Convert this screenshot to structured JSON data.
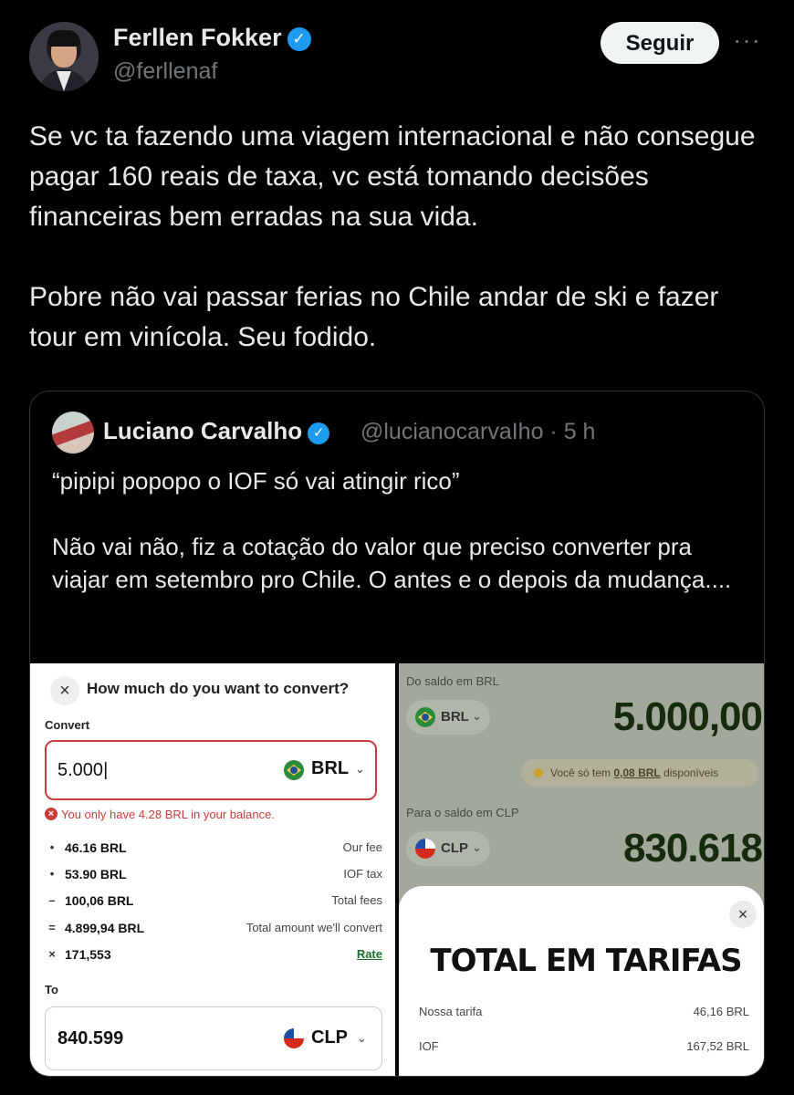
{
  "author": {
    "name": "Ferllen Fokker",
    "handle": "@ferllenaf",
    "follow_label": "Seguir",
    "more_label": "···"
  },
  "tweet": {
    "paragraph1": "Se vc ta fazendo uma viagem internacional e não consegue pagar 160 reais de taxa, vc está tomando decisões financeiras bem erradas na sua vida.",
    "paragraph2": "Pobre não vai passar ferias no Chile andar de ski e fazer tour em vinícola. Seu fodido."
  },
  "quote": {
    "name": "Luciano Carvalho",
    "handle_time": "@lucianocarvaIho · 5 h",
    "paragraph1": "“pipipi popopo o IOF só vai atingir rico”",
    "paragraph2": "Não vai não, fiz a cotação do valor que preciso converter pra viajar em setembro pro Chile. O antes e o depois da mudança...."
  },
  "left_panel": {
    "title": "How much do you want to convert?",
    "convert_label": "Convert",
    "input_value": "5.000",
    "from_currency": "BRL",
    "error": "You only have 4.28 BRL in your balance.",
    "fees": [
      {
        "symbol": "•",
        "value": "46.16 BRL",
        "label": "Our fee"
      },
      {
        "symbol": "•",
        "value": "53.90 BRL",
        "label": "IOF tax"
      },
      {
        "symbol": "–",
        "value": "100,06 BRL",
        "label": "Total fees"
      },
      {
        "symbol": "=",
        "value": "4.899,94 BRL",
        "label": "Total amount we'll convert"
      },
      {
        "symbol": "×",
        "value": "171,553",
        "label": "Rate"
      }
    ],
    "to_label": "To",
    "to_value": "840.599",
    "to_currency": "CLP"
  },
  "right_panel": {
    "from_label": "Do saldo em BRL",
    "from_currency": "BRL",
    "from_amount": "5.000,00",
    "warning_prefix": "Você só tem ",
    "warning_amount": "0,08 BRL",
    "warning_suffix": " disponíveis",
    "to_label": "Para o saldo em CLP",
    "to_currency": "CLP",
    "to_amount": "830.618",
    "sheet_title": "TOTAL EM TARIFAS",
    "lines": [
      {
        "label": "Nossa tarifa",
        "value": "46,16 BRL"
      },
      {
        "label": "IOF",
        "value": "167,52 BRL"
      }
    ]
  },
  "colors": {
    "background": "#000000",
    "verified": "#1d9bf0",
    "error": "#c93c3c",
    "bank_amount": "#162a0c"
  }
}
